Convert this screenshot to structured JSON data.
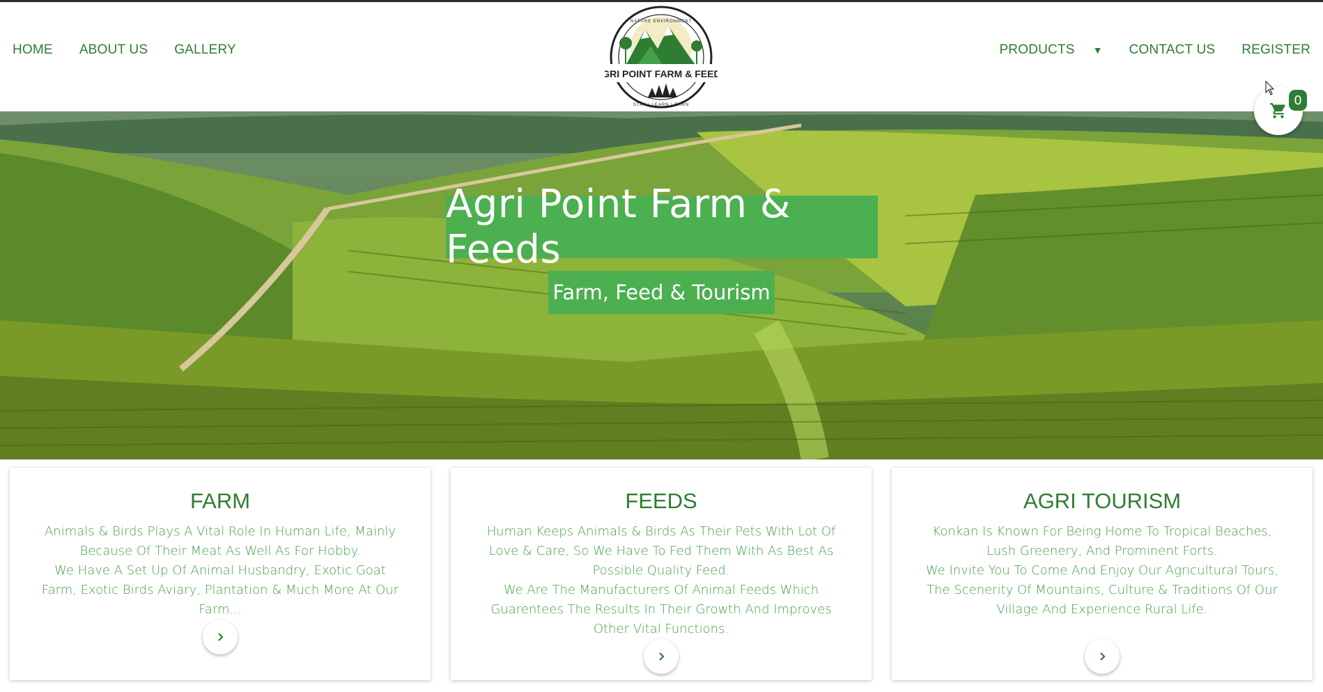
{
  "nav": {
    "left": [
      "HOME",
      "ABOUT US",
      "GALLERY"
    ],
    "products": "PRODUCTS",
    "contact": "CONTACT US",
    "register": "REGISTER"
  },
  "logo": {
    "name": "AGRI POINT FARM & FEEDS",
    "arc_top": "NATURE ENVIRONMENT",
    "arc_bottom": "STAY | LEARN | EARN"
  },
  "cart": {
    "icon": "cart-icon",
    "count": "0"
  },
  "hero": {
    "title": "Agri Point Farm & Feeds",
    "subtitle": "Farm, Feed & Tourism"
  },
  "cards": [
    {
      "title": "FARM",
      "lines": [
        "Animals & Birds Plays A Vital Role In Human Life, Mainly Because Of Their Meat As Well As For Hobby.",
        "We Have A Set Up Of Animal Husbandry, Exotic Goat Farm, Exotic Birds Aviary, Plantation & Much More At Our Farm..."
      ]
    },
    {
      "title": "FEEDS",
      "lines": [
        "Human Keeps Animals & Birds As Their Pets With Lot Of Love & Care, So We Have To Fed Them With As Best As Possible Quality Feed.",
        "We Are The Manufacturers Of Animal Feeds Which Guarentees The Results In Their Growth And Improves Other Vital Functions."
      ]
    },
    {
      "title": "AGRI TOURISM",
      "lines": [
        "Konkan Is Known For Being Home To Tropical Beaches, Lush Greenery, And Prominent Forts.",
        "We Invite You To Come And Enjoy Our Agricultural Tours, The Scenerity Of Mountains, Culture & Traditions Of Our Village And Experience Rural Life."
      ]
    }
  ],
  "colors": {
    "brand_green": "#4caf50",
    "text_green": "#2e7d32",
    "body_green": "#43a047"
  }
}
